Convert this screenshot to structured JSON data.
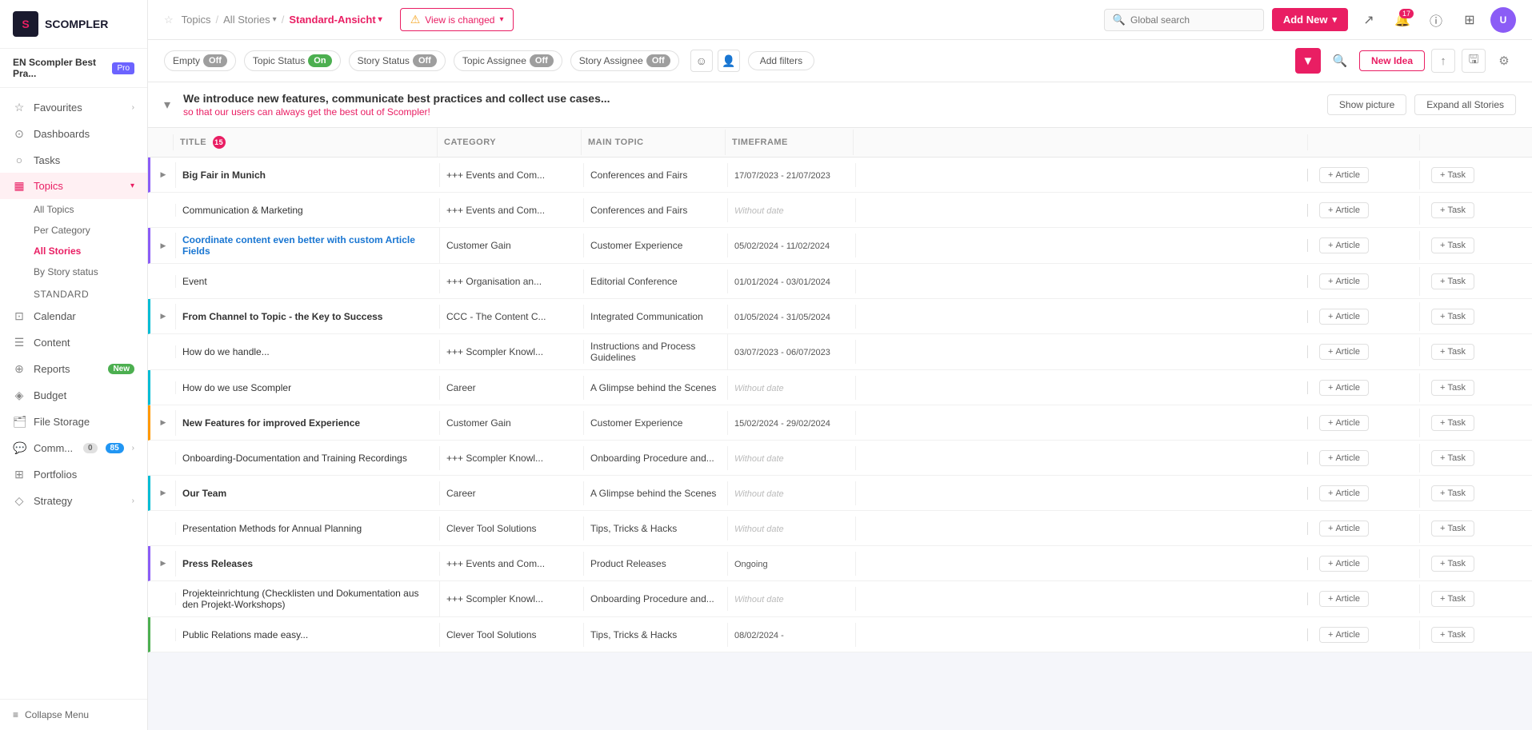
{
  "sidebar": {
    "logo": "S",
    "logo_text": "SCOMPLER",
    "workspace": "EN Scompler Best Pra...",
    "workspace_badge": "Pro",
    "nav_items": [
      {
        "id": "favourites",
        "icon": "★",
        "label": "Favourites",
        "has_arrow": true
      },
      {
        "id": "dashboards",
        "icon": "⊞",
        "label": "Dashboards"
      },
      {
        "id": "tasks",
        "icon": "○",
        "label": "Tasks"
      },
      {
        "id": "topics",
        "icon": "▦",
        "label": "Topics",
        "active": true,
        "has_dropdown": true
      },
      {
        "id": "calendar",
        "icon": "⊡",
        "label": "Calendar"
      },
      {
        "id": "content",
        "icon": "☰",
        "label": "Content"
      },
      {
        "id": "reports",
        "icon": "⊕",
        "label": "Reports",
        "badge": "New",
        "badge_color": "green"
      },
      {
        "id": "budget",
        "icon": "💰",
        "label": "Budget"
      },
      {
        "id": "file-storage",
        "icon": "📁",
        "label": "File Storage"
      },
      {
        "id": "comms",
        "icon": "💬",
        "label": "Comm...",
        "badge1": "0",
        "badge2": "85",
        "has_arrow": true
      },
      {
        "id": "portfolios",
        "icon": "⊞",
        "label": "Portfolios"
      },
      {
        "id": "strategy",
        "icon": "◈",
        "label": "Strategy",
        "has_arrow": true
      }
    ],
    "topics_sub": [
      {
        "id": "all-topics",
        "label": "All Topics"
      },
      {
        "id": "per-category",
        "label": "Per Category"
      },
      {
        "id": "all-stories",
        "label": "All Stories",
        "active": true
      },
      {
        "id": "by-story-status",
        "label": "By Story status"
      }
    ],
    "topics_view_label": "Standard",
    "collapse_menu": "Collapse Menu"
  },
  "topnav": {
    "breadcrumb": [
      {
        "label": "Topics"
      },
      {
        "label": "All Stories"
      },
      {
        "label": "Standard-Ansicht",
        "current": true
      }
    ],
    "view_changed": "View is changed",
    "search_placeholder": "Global search",
    "add_new": "Add New",
    "notif_count": "17"
  },
  "filterbar": {
    "filters": [
      {
        "id": "empty",
        "label": "Empty",
        "toggle": "Off",
        "state": "off"
      },
      {
        "id": "topic-status",
        "label": "Topic Status",
        "toggle": "On",
        "state": "on"
      },
      {
        "id": "story-status",
        "label": "Story Status",
        "toggle": "Off",
        "state": "off"
      },
      {
        "id": "topic-assignee",
        "label": "Topic Assignee",
        "toggle": "Off",
        "state": "off"
      },
      {
        "id": "story-assignee",
        "label": "Story Assignee",
        "toggle": "Off",
        "state": "off"
      }
    ],
    "add_filters": "Add filters",
    "new_idea": "New Idea"
  },
  "mission": {
    "title": "We introduce new features, communicate best practices and collect use cases...",
    "subtitle": "so that our",
    "subtitle_link": "users",
    "subtitle_end": "can always get the best out of Scompler!",
    "show_picture": "Show picture",
    "expand_all": "Expand all Stories"
  },
  "table": {
    "columns": [
      "",
      "TITLE",
      "CATEGORY",
      "MAIN TOPIC",
      "TIMEFRAME",
      "",
      "",
      ""
    ],
    "title_badge": "15",
    "rows": [
      {
        "id": 1,
        "expandable": true,
        "indicator": "purple",
        "title": "Big Fair in Munich",
        "title_style": "bold",
        "category": "+++ Events and Com...",
        "main_topic": "Conferences and Fairs",
        "timeframe": "17/07/2023 - 21/07/2023",
        "timeframe_type": "date"
      },
      {
        "id": 2,
        "expandable": false,
        "indicator": "",
        "title": "Communication & Marketing",
        "title_style": "normal",
        "category": "+++ Events and Com...",
        "main_topic": "Conferences and Fairs",
        "timeframe": "Without date",
        "timeframe_type": "empty"
      },
      {
        "id": 3,
        "expandable": true,
        "indicator": "purple",
        "title": "Coordinate content even better with custom Article Fields",
        "title_style": "bold link",
        "category": "Customer Gain",
        "main_topic": "Customer Experience",
        "timeframe": "05/02/2024 - 11/02/2024",
        "timeframe_type": "date"
      },
      {
        "id": 4,
        "expandable": false,
        "indicator": "",
        "title": "Event",
        "title_style": "normal",
        "category": "+++ Organisation an...",
        "main_topic": "Editorial Conference",
        "timeframe": "01/01/2024 - 03/01/2024",
        "timeframe_type": "date"
      },
      {
        "id": 5,
        "expandable": true,
        "indicator": "teal",
        "title": "From Channel to Topic - the Key to Success",
        "title_style": "bold",
        "category": "CCC - The Content C...",
        "main_topic": "Integrated Communication",
        "timeframe": "01/05/2024 - 31/05/2024",
        "timeframe_type": "date"
      },
      {
        "id": 6,
        "expandable": false,
        "indicator": "",
        "title": "How do we handle...",
        "title_style": "normal",
        "category": "+++ Scompler Knowl...",
        "main_topic": "Instructions and Process Guidelines",
        "timeframe": "03/07/2023 - 06/07/2023",
        "timeframe_type": "date"
      },
      {
        "id": 7,
        "expandable": false,
        "indicator": "teal",
        "title": "How do we use Scompler",
        "title_style": "normal",
        "category": "Career",
        "main_topic": "A Glimpse behind the Scenes",
        "timeframe": "Without date",
        "timeframe_type": "empty"
      },
      {
        "id": 8,
        "expandable": true,
        "indicator": "orange",
        "title": "New Features for improved Experience",
        "title_style": "bold",
        "category": "Customer Gain",
        "main_topic": "Customer Experience",
        "timeframe": "15/02/2024 - 29/02/2024",
        "timeframe_type": "date"
      },
      {
        "id": 9,
        "expandable": false,
        "indicator": "",
        "title": "Onboarding-Documentation and Training Recordings",
        "title_style": "normal",
        "category": "+++ Scompler Knowl...",
        "main_topic": "Onboarding Procedure and...",
        "timeframe": "Without date",
        "timeframe_type": "empty"
      },
      {
        "id": 10,
        "expandable": true,
        "indicator": "teal",
        "title": "Our Team",
        "title_style": "bold",
        "category": "Career",
        "main_topic": "A Glimpse behind the Scenes",
        "timeframe": "Without date",
        "timeframe_type": "empty"
      },
      {
        "id": 11,
        "expandable": false,
        "indicator": "",
        "title": "Presentation Methods for Annual Planning",
        "title_style": "normal",
        "category": "Clever Tool Solutions",
        "main_topic": "Tips, Tricks & Hacks",
        "timeframe": "Without date",
        "timeframe_type": "empty"
      },
      {
        "id": 12,
        "expandable": true,
        "indicator": "purple",
        "title": "Press Releases",
        "title_style": "bold",
        "category": "+++ Events and Com...",
        "main_topic": "Product Releases",
        "timeframe": "Ongoing",
        "timeframe_type": "ongoing"
      },
      {
        "id": 13,
        "expandable": false,
        "indicator": "",
        "title": "Projekteinrichtung (Checklisten und Dokumentation aus den Projekt-Workshops)",
        "title_style": "normal",
        "category": "+++ Scompler Knowl...",
        "main_topic": "Onboarding Procedure and...",
        "timeframe": "Without date",
        "timeframe_type": "empty"
      },
      {
        "id": 14,
        "expandable": false,
        "indicator": "green",
        "title": "Public Relations made easy...",
        "title_style": "normal",
        "category": "Clever Tool Solutions",
        "main_topic": "Tips, Tricks & Hacks",
        "timeframe": "08/02/2024 -",
        "timeframe_type": "date"
      }
    ]
  },
  "icons": {
    "star": "☆",
    "chevron_right": "›",
    "chevron_down": "▾",
    "chevron_left": "‹",
    "expand": "▶",
    "search": "🔍",
    "bell": "🔔",
    "info": "ⓘ",
    "grid": "⊞",
    "filter": "▼",
    "warning": "⚠",
    "plus": "+",
    "settings": "⚙",
    "export": "↗",
    "share": "⬆",
    "collapse": "≡"
  }
}
